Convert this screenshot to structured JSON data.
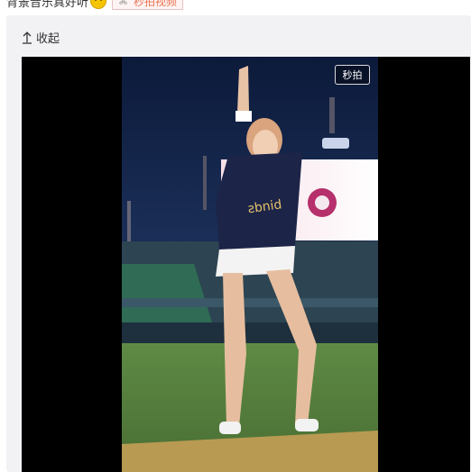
{
  "post": {
    "text": "背景音乐真好听",
    "emoji_icon": "grin-emoji-icon",
    "video_tag": {
      "label": "秒拍视频",
      "icon": "link-icon"
    }
  },
  "media": {
    "collapse_label": "收起",
    "collapse_icon": "arrow-up-icon",
    "badge": "秒拍"
  },
  "colors": {
    "card_bg": "#f2f2f5",
    "tag_text": "#eb7350",
    "player_bg": "#000000"
  }
}
